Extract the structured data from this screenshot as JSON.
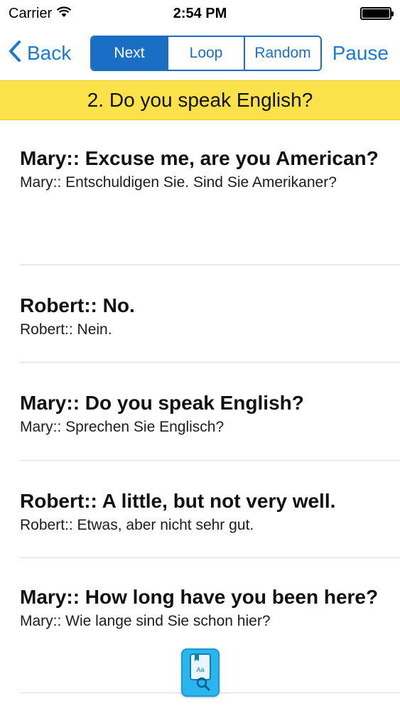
{
  "status_bar": {
    "carrier": "Carrier",
    "time": "2:54 PM"
  },
  "nav": {
    "back_label": "Back",
    "segments": [
      "Next",
      "Loop",
      "Random"
    ],
    "active_segment": "Next",
    "pause_label": "Pause"
  },
  "lesson": {
    "title": "2. Do you speak English?"
  },
  "dialog": [
    {
      "en": "Mary:: Excuse me, are you American?",
      "de": "Mary:: Entschuldigen Sie. Sind Sie Amerikaner?"
    },
    {
      "en": "Robert:: No.",
      "de": "Robert:: Nein."
    },
    {
      "en": "Mary:: Do you speak English?",
      "de": "Mary:: Sprechen Sie Englisch?"
    },
    {
      "en": "Robert:: A little, but not very well.",
      "de": "Robert:: Etwas, aber nicht sehr gut."
    },
    {
      "en": "Mary:: How long have you been here?",
      "de": "Mary:: Wie lange sind Sie schon hier?"
    }
  ],
  "dictionary_button": {
    "icon": "dictionary-search-icon",
    "glyph": "Aa"
  },
  "colors": {
    "accent": "#1a6fc4",
    "banner": "#fbe24a",
    "dict_button": "#29b6ef"
  }
}
